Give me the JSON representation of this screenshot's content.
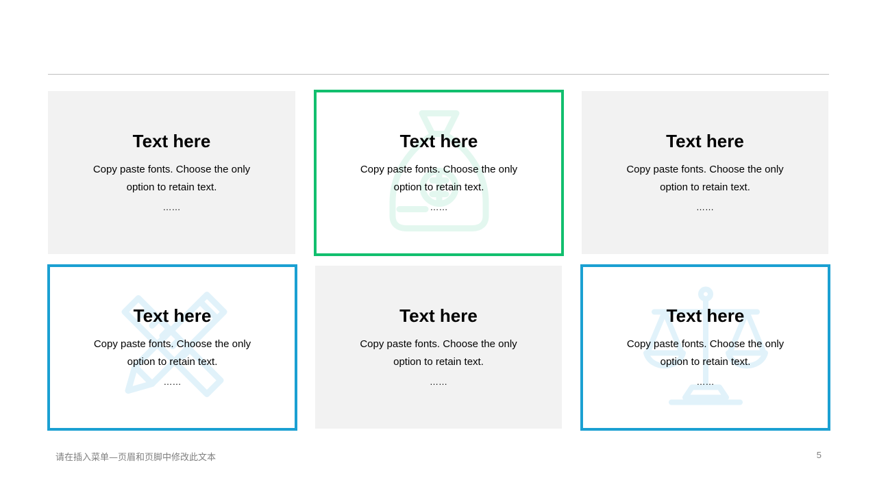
{
  "colors": {
    "green": "#12bf6e",
    "blue": "#1ba0d2",
    "grey_card": "#f2f2f2",
    "icon_green_tint": "#e3f7ef",
    "icon_blue_tint": "#e1f2fa"
  },
  "cards": [
    {
      "title": "Text here",
      "body": "Copy paste fonts. Choose the only option to retain text.",
      "dots": "……",
      "style": "grey",
      "icon": ""
    },
    {
      "title": "Text here",
      "body": "Copy paste fonts. Choose the only option to retain text.",
      "dots": "……",
      "style": "outlined-green",
      "icon": "money-bag-icon"
    },
    {
      "title": "Text here",
      "body": "Copy paste fonts. Choose the only option to retain text.",
      "dots": "……",
      "style": "grey",
      "icon": ""
    },
    {
      "title": "Text here",
      "body": "Copy paste fonts. Choose the only option to retain text.",
      "dots": "……",
      "style": "outlined-blue",
      "icon": "ruler-pencil-icon"
    },
    {
      "title": "Text here",
      "body": "Copy paste fonts. Choose the only option to retain text.",
      "dots": "……",
      "style": "grey",
      "icon": ""
    },
    {
      "title": "Text here",
      "body": "Copy paste fonts. Choose the only option to retain text.",
      "dots": "……",
      "style": "outlined-blue",
      "icon": "balance-scale-icon"
    }
  ],
  "footer": {
    "text": "请在插入菜单—页眉和页脚中修改此文本",
    "page_number": "5"
  }
}
